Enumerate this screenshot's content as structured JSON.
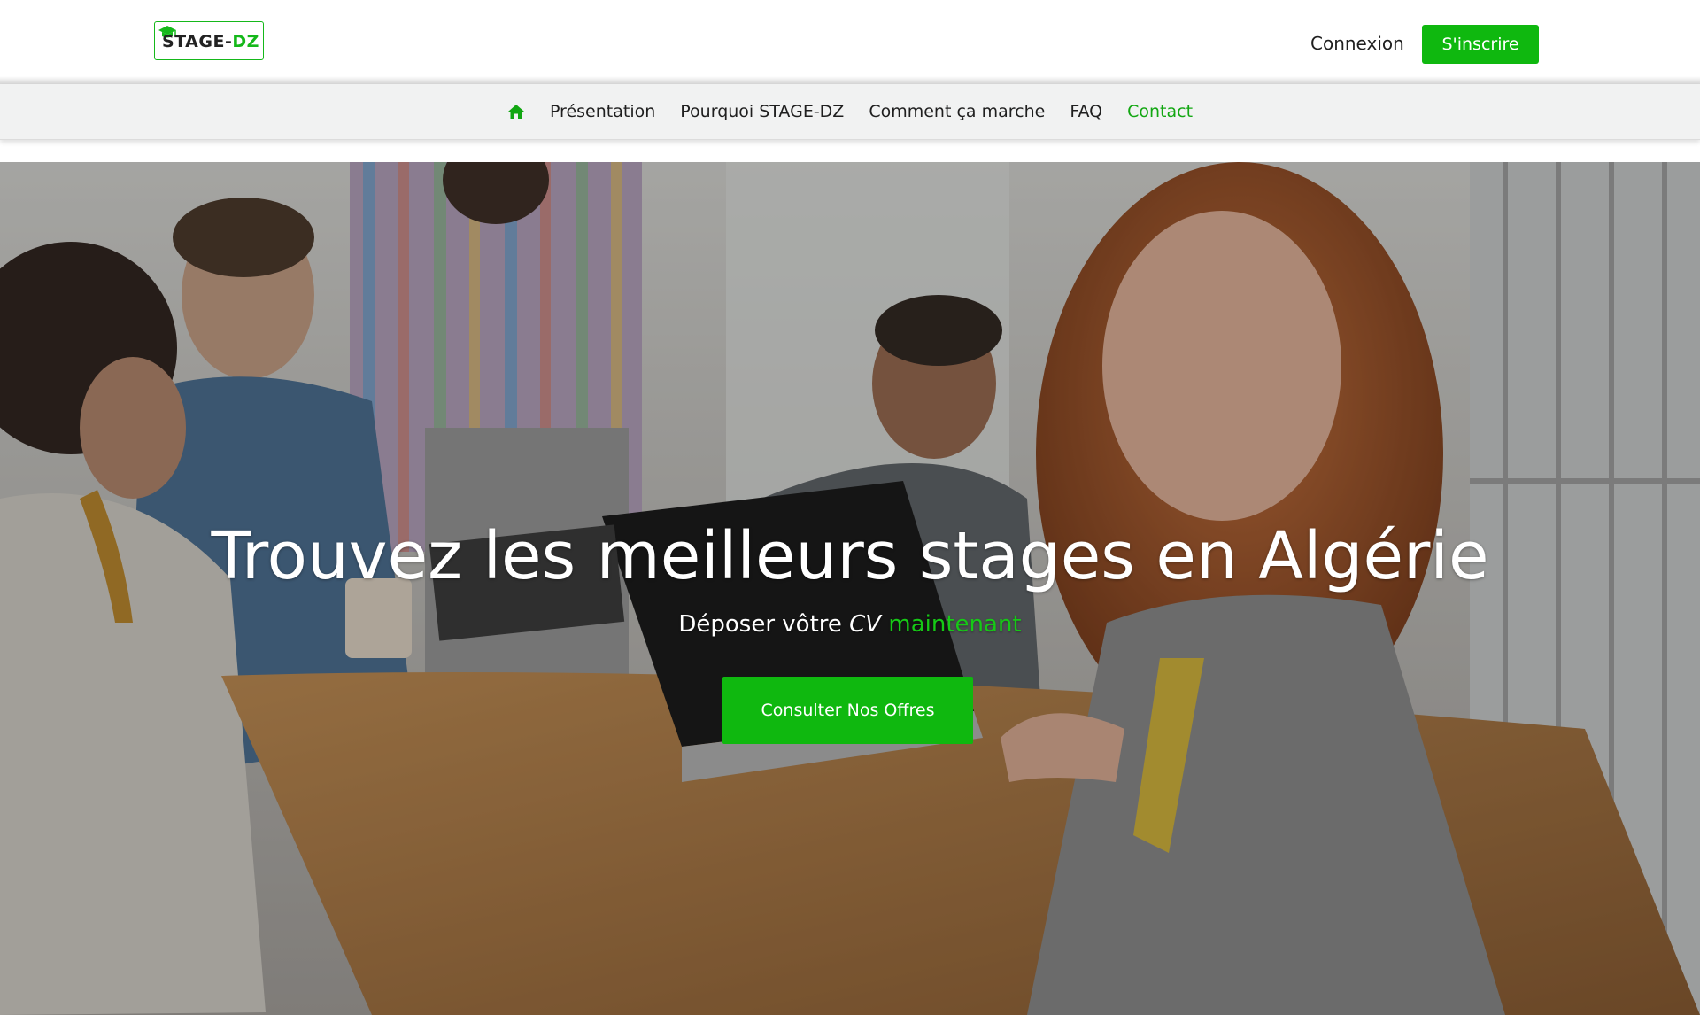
{
  "header": {
    "logo": {
      "prefix": "STAGE-",
      "highlight": "DZ"
    },
    "login_label": "Connexion",
    "signup_label": "S'inscrire"
  },
  "nav": {
    "home_icon": "home-icon",
    "items": [
      {
        "label": "Présentation",
        "active": false
      },
      {
        "label": "Pourquoi STAGE-DZ",
        "active": false
      },
      {
        "label": "Comment ça marche",
        "active": false
      },
      {
        "label": "FAQ",
        "active": false
      },
      {
        "label": "Contact",
        "active": true
      }
    ]
  },
  "hero": {
    "title": "Trouvez les meilleurs stages en Algérie",
    "subtitle": {
      "part1": "Déposer vôtre ",
      "italic": "CV",
      "space": " ",
      "green": "maintenant"
    },
    "cta_label": "Consulter Nos Offres"
  },
  "colors": {
    "brand_green": "#0fb80f",
    "nav_active": "#12a712",
    "navbar_bg": "#f1f2f2"
  }
}
